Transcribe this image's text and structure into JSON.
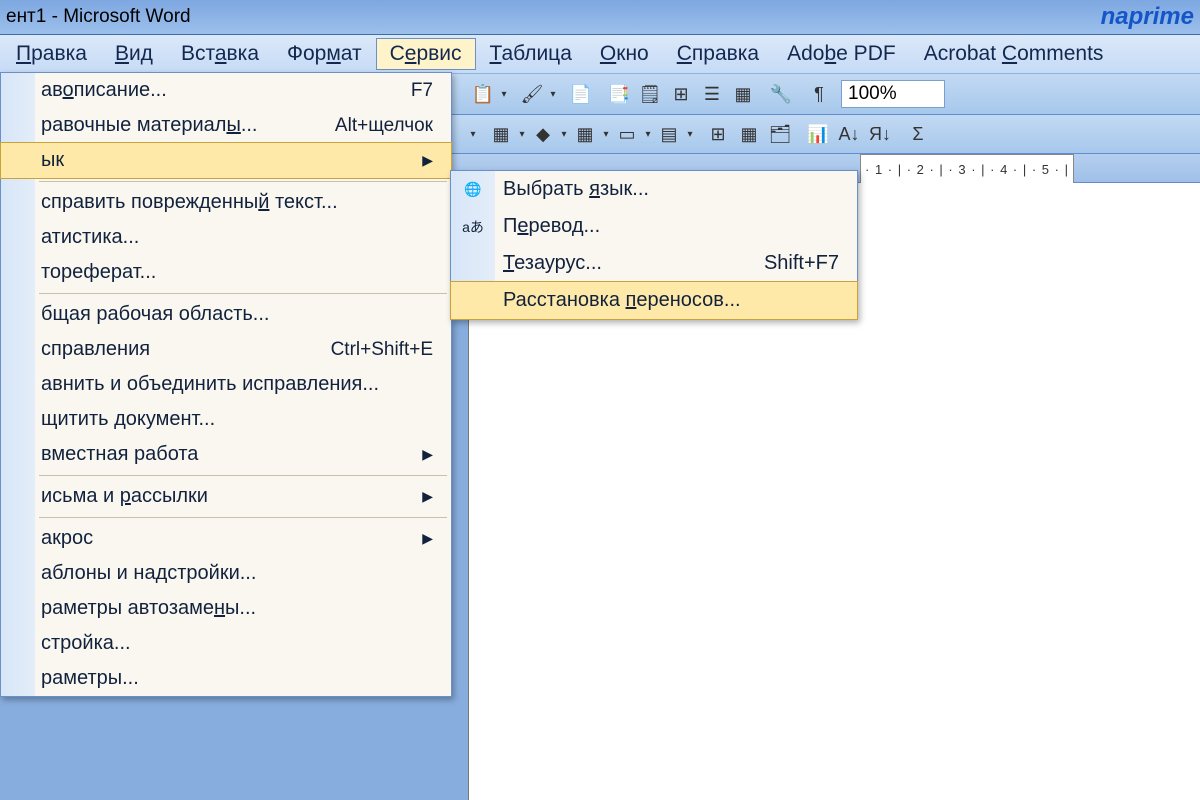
{
  "title": "ент1 - Microsoft Word",
  "watermark": "naprime",
  "menubar": [
    {
      "pre": "",
      "ul": "П",
      "post": "равка"
    },
    {
      "pre": "",
      "ul": "В",
      "post": "ид"
    },
    {
      "pre": "Вст",
      "ul": "а",
      "post": "вка"
    },
    {
      "pre": "Фор",
      "ul": "м",
      "post": "ат"
    },
    {
      "pre": "С",
      "ul": "е",
      "post": "рвис",
      "active": true
    },
    {
      "pre": "",
      "ul": "Т",
      "post": "аблица"
    },
    {
      "pre": "",
      "ul": "О",
      "post": "кно"
    },
    {
      "pre": "",
      "ul": "С",
      "post": "правка"
    },
    {
      "pre": "Ado",
      "ul": "b",
      "post": "e PDF"
    },
    {
      "pre": "Acrobat ",
      "ul": "C",
      "post": "omments"
    }
  ],
  "zoom": "100%",
  "ruler_text": "· 1 · | · 2 · | · 3 · | · 4 · | · 5 · |",
  "servis_menu": [
    {
      "pre": "ав",
      "ul": "о",
      "post": "писание...",
      "shortcut": "F7"
    },
    {
      "pre": "равочные материал",
      "ul": "ы",
      "post": "...",
      "shortcut": "Alt+щелчок"
    },
    {
      "pre": "ык",
      "ul": "",
      "post": "",
      "arrow": true,
      "hover": true
    },
    {
      "sep": true
    },
    {
      "pre": "справить поврежденны",
      "ul": "й",
      "post": " текст..."
    },
    {
      "pre": "атистика...",
      "ul": "",
      "post": ""
    },
    {
      "pre": "тореферат...",
      "ul": "",
      "post": ""
    },
    {
      "sep": true
    },
    {
      "pre": "бщая рабочая область...",
      "ul": "",
      "post": ""
    },
    {
      "pre": "справления",
      "ul": "",
      "post": "",
      "shortcut": "Ctrl+Shift+E"
    },
    {
      "pre": "авнить и объединить исправления...",
      "ul": "",
      "post": ""
    },
    {
      "pre": "щитить документ...",
      "ul": "",
      "post": ""
    },
    {
      "pre": "вместная работа",
      "ul": "",
      "post": "",
      "arrow": true
    },
    {
      "sep": true
    },
    {
      "pre": "исьма и ",
      "ul": "р",
      "post": "ассылки",
      "arrow": true
    },
    {
      "sep": true
    },
    {
      "pre": "акрос",
      "ul": "",
      "post": "",
      "arrow": true
    },
    {
      "pre": "аблоны и надстройки...",
      "ul": "",
      "post": ""
    },
    {
      "pre": "раметры автозаме",
      "ul": "н",
      "post": "ы..."
    },
    {
      "pre": "стройка...",
      "ul": "",
      "post": ""
    },
    {
      "pre": "раметры...",
      "ul": "",
      "post": ""
    }
  ],
  "lang_submenu": [
    {
      "pre": "Выбрать ",
      "ul": "я",
      "post": "зык...",
      "icon": "🌐"
    },
    {
      "pre": "П",
      "ul": "е",
      "post": "ревод...",
      "icon": "aあ"
    },
    {
      "pre": "",
      "ul": "Т",
      "post": "езаурус...",
      "shortcut": "Shift+F7"
    },
    {
      "pre": "Расстановка ",
      "ul": "п",
      "post": "ереносов...",
      "hover": true
    }
  ],
  "tb1_icons": [
    "📋",
    "▾",
    "",
    "🖌",
    "▾",
    "",
    "📄",
    "",
    "📑",
    "🗒",
    "⊞",
    "☰",
    "▦",
    "",
    "🔧",
    "",
    "¶"
  ],
  "tb2_icons": [
    "▾",
    "",
    "▦",
    "▾",
    "◆",
    "▾",
    "▦",
    "▾",
    "▭",
    "▾",
    "▤",
    "▾",
    "",
    "⊞",
    "▦",
    "🗂",
    "",
    "📊",
    "A↓",
    "Я↓",
    "",
    "Σ"
  ]
}
